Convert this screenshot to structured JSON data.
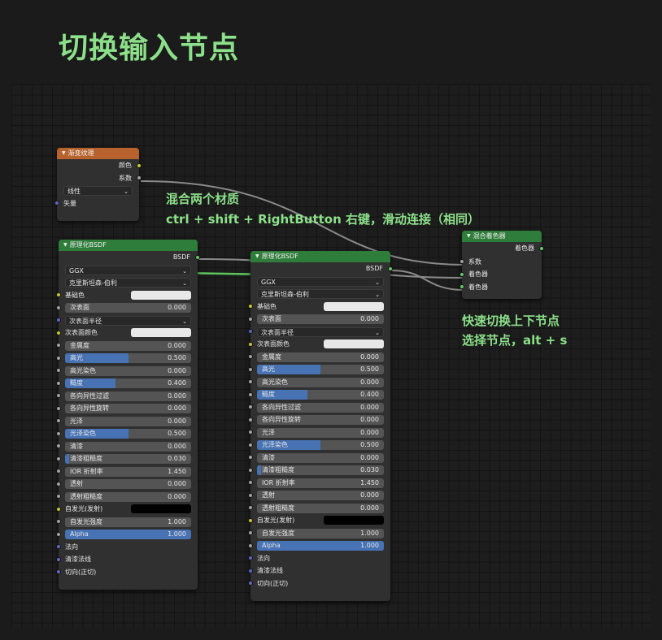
{
  "page_title": "切换输入节点",
  "annotations": {
    "mix_line1": "混合两个材质",
    "mix_line2": "ctrl + shift + RightButton 右键，滑动连接（相同）",
    "switch_line1": "快速切换上下节点",
    "switch_line2": "选择节点，alt + s"
  },
  "gradient_node": {
    "title": "渐变纹理",
    "out_color": "颜色",
    "out_factor": "系数",
    "type_value": "线性",
    "in_vector": "矢量"
  },
  "mix_node": {
    "title": "混合着色器",
    "out_shader": "着色器",
    "in_factor": "系数",
    "in_shader1": "着色器",
    "in_shader2": "着色器"
  },
  "bsdf_nodes": [
    {
      "title": "原理化BSDF",
      "out_bsdf": "BSDF",
      "distribution": "GGX",
      "subsurface_method": "克里斯坦森-伯利",
      "base_color": "基础色",
      "rows": [
        {
          "label": "次表面",
          "value": "0.000",
          "fill": 0
        },
        {
          "label": "次表面半径",
          "kind": "dropdown"
        },
        {
          "label": "次表面颜色",
          "kind": "color",
          "swatch": "#e8e8e8"
        },
        {
          "label": "金属度",
          "value": "0.000",
          "fill": 0
        },
        {
          "label": "高光",
          "value": "0.500",
          "fill": 0.5
        },
        {
          "label": "高光染色",
          "value": "0.000",
          "fill": 0
        },
        {
          "label": "糙度",
          "value": "0.400",
          "fill": 0.4
        },
        {
          "label": "各向异性过滤",
          "value": "0.000",
          "fill": 0
        },
        {
          "label": "各向异性旋转",
          "value": "0.000",
          "fill": 0
        },
        {
          "label": "光泽",
          "value": "0.000",
          "fill": 0
        },
        {
          "label": "光泽染色",
          "value": "0.500",
          "fill": 0.5
        },
        {
          "label": "清漆",
          "value": "0.000",
          "fill": 0
        },
        {
          "label": "清漆粗糙度",
          "value": "0.030",
          "fill": 0.03
        },
        {
          "label": "IOR 折射率",
          "value": "1.450",
          "fill": 0
        },
        {
          "label": "透射",
          "value": "0.000",
          "fill": 0
        },
        {
          "label": "透射粗糙度",
          "value": "0.000",
          "fill": 0
        },
        {
          "label": "自发光(发射)",
          "kind": "color",
          "swatch": "#000000"
        },
        {
          "label": "自发光强度",
          "value": "1.000",
          "fill": 0
        },
        {
          "label": "Alpha",
          "value": "1.000",
          "fill": 1
        },
        {
          "label": "法向",
          "kind": "input"
        },
        {
          "label": "清漆法线",
          "kind": "input"
        },
        {
          "label": "切向(正切)",
          "kind": "input"
        }
      ]
    },
    {
      "title": "原理化BSDF",
      "out_bsdf": "BSDF",
      "distribution": "GGX",
      "subsurface_method": "克里斯坦森-伯利",
      "base_color": "基础色",
      "rows": [
        {
          "label": "次表面",
          "value": "0.000",
          "fill": 0
        },
        {
          "label": "次表面半径",
          "kind": "dropdown"
        },
        {
          "label": "次表面颜色",
          "kind": "color",
          "swatch": "#e8e8e8"
        },
        {
          "label": "金属度",
          "value": "0.000",
          "fill": 0
        },
        {
          "label": "高光",
          "value": "0.500",
          "fill": 0.5
        },
        {
          "label": "高光染色",
          "value": "0.000",
          "fill": 0
        },
        {
          "label": "糙度",
          "value": "0.400",
          "fill": 0.4
        },
        {
          "label": "各向异性过滤",
          "value": "0.000",
          "fill": 0
        },
        {
          "label": "各向异性旋转",
          "value": "0.000",
          "fill": 0
        },
        {
          "label": "光泽",
          "value": "0.000",
          "fill": 0
        },
        {
          "label": "光泽染色",
          "value": "0.500",
          "fill": 0.5
        },
        {
          "label": "清漆",
          "value": "0.000",
          "fill": 0
        },
        {
          "label": "清漆粗糙度",
          "value": "0.030",
          "fill": 0.03
        },
        {
          "label": "IOR 折射率",
          "value": "1.450",
          "fill": 0
        },
        {
          "label": "透射",
          "value": "0.000",
          "fill": 0
        },
        {
          "label": "透射粗糙度",
          "value": "0.000",
          "fill": 0
        },
        {
          "label": "自发光(发射)",
          "kind": "color",
          "swatch": "#000000"
        },
        {
          "label": "自发光强度",
          "value": "1.000",
          "fill": 0
        },
        {
          "label": "Alpha",
          "value": "1.000",
          "fill": 1
        },
        {
          "label": "法向",
          "kind": "input"
        },
        {
          "label": "清漆法线",
          "kind": "input"
        },
        {
          "label": "切向(正切)",
          "kind": "input"
        }
      ]
    }
  ],
  "colors": {
    "accent_text": "#8ce08a",
    "node_green_header": "#2e7d3a",
    "node_orange_header": "#b8632d",
    "slider_fill": "#4772b3",
    "link_gray": "#8a8a8a",
    "link_green": "#5cc75c"
  }
}
